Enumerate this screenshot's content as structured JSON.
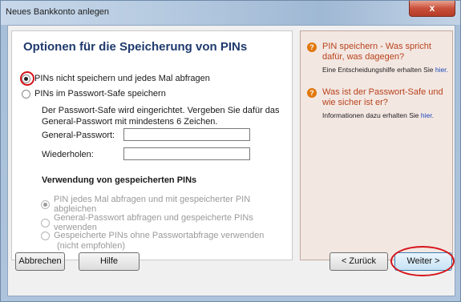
{
  "window": {
    "title": "Neues Bankkonto anlegen",
    "close_label": "x"
  },
  "main": {
    "heading": "Optionen für die Speicherung von PINs",
    "radio_1_label": "PINs nicht speichern und jedes Mal abfragen",
    "radio_2_label": "PINs im Passwort-Safe speichern",
    "info_text": "Der Passwort-Safe wird eingerichtet. Vergeben Sie dafür das General-Passwort mit mindestens 6 Zeichen.",
    "general_password_label": "General-Passwort:",
    "repeat_label": "Wiederholen:",
    "usage_heading": "Verwendung von gespeicherten PINs",
    "usage_options": [
      "PIN jedes Mal abfragen und mit gespeicherter PIN abgleichen",
      "General-Passwort abfragen und gespeicherte PINs verwenden",
      "Gespeicherte PINs ohne Passwortabfrage verwenden"
    ],
    "usage_option_3_note": "(nicht empfohlen)"
  },
  "help": {
    "item_1_title": "PIN speichern - Was spricht dafür, was dagegen?",
    "item_1_desc_prefix": "Eine Entscheidungshilfe erhalten Sie ",
    "item_1_link": "hier.",
    "item_2_title": "Was ist der Passwort-Safe und wie sicher ist er?",
    "item_2_desc_prefix": "Informationen dazu erhalten Sie ",
    "item_2_link": "hier."
  },
  "buttons": {
    "cancel": "Abbrechen",
    "help": "Hilfe",
    "back": "< Zurück",
    "next": "Weiter >"
  },
  "colors": {
    "annotation_red": "#d6131a",
    "heading_blue": "#1f3a6e",
    "help_orange": "#e2770b"
  }
}
